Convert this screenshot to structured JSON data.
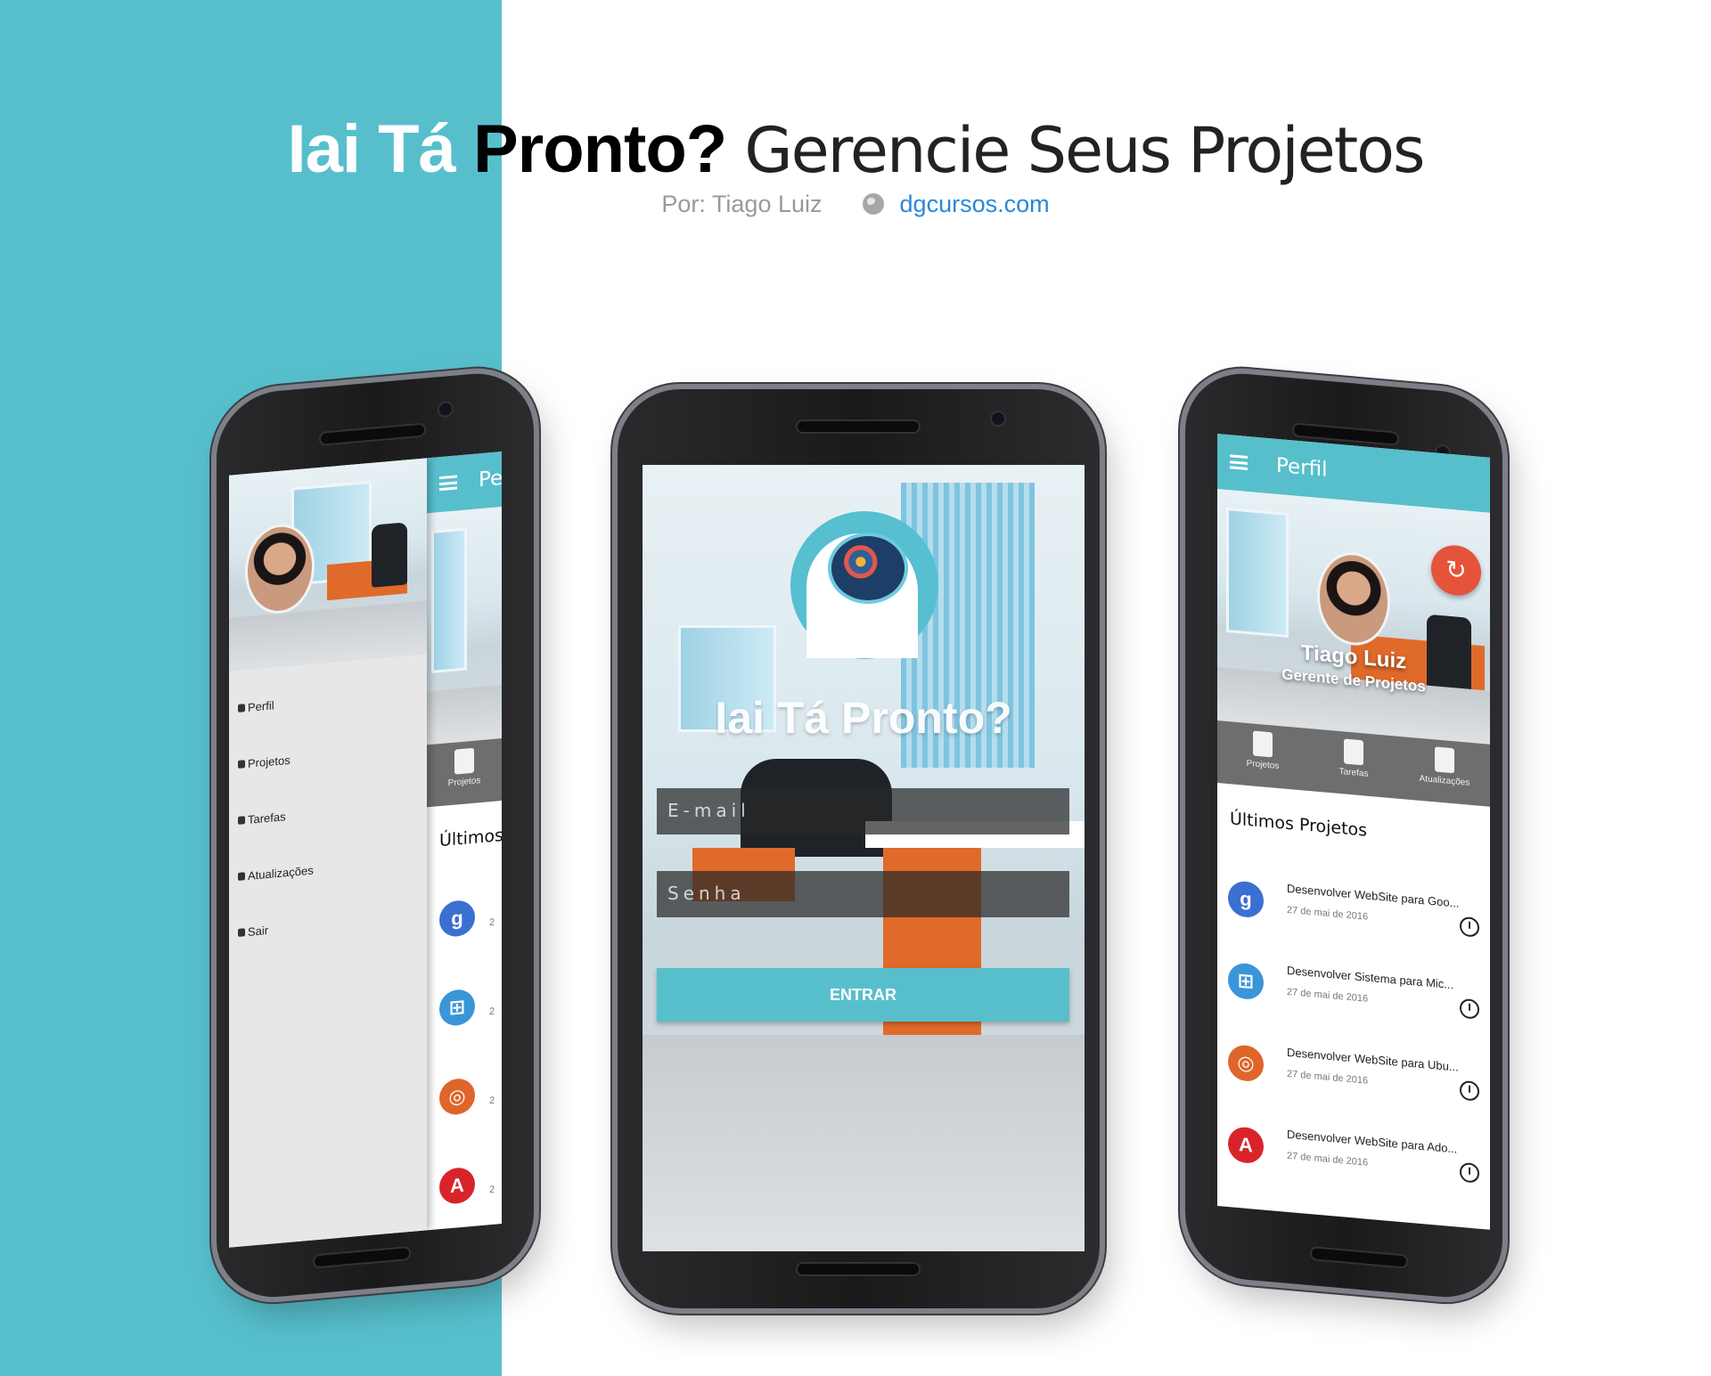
{
  "header": {
    "title_part1": "Iai Tá",
    "title_part2": "Pronto?",
    "title_part3": "Gerencie Seus Projetos",
    "byline": "Por: Tiago Luiz",
    "website": "dgcursos.com"
  },
  "colors": {
    "teal": "#57bfcc",
    "orange_fab": "#e6533b",
    "link": "#2a88d9"
  },
  "login_screen": {
    "app_title": "Iai Tá Pronto?",
    "email_placeholder": "E-mail",
    "password_placeholder": "Senha",
    "enter_button": "ENTRAR"
  },
  "profile_screen": {
    "appbar_title": "Perfil",
    "user_name": "Tiago Luiz",
    "user_role": "Gerente de Projetos",
    "tabs": [
      {
        "label": "Projetos",
        "icon": "folder-icon"
      },
      {
        "label": "Tarefas",
        "icon": "clipboard-icon"
      },
      {
        "label": "Atualizações",
        "icon": "users-icon"
      }
    ],
    "section_title": "Últimos Projetos",
    "projects": [
      {
        "name": "Desenvolver WebSite para Goo...",
        "date": "27 de mai de 2016",
        "icon": "google-icon",
        "color": "#3b6fd1",
        "glyph": "g"
      },
      {
        "name": "Desenvolver Sistema para Mic...",
        "date": "27 de mai de 2016",
        "icon": "windows-icon",
        "color": "#3b95d9",
        "glyph": "⊞"
      },
      {
        "name": "Desenvolver WebSite para Ubu...",
        "date": "27 de mai de 2016",
        "icon": "ubuntu-icon",
        "color": "#e0652b",
        "glyph": "◎"
      },
      {
        "name": "Desenvolver WebSite para Ado...",
        "date": "27 de mai de 2016",
        "icon": "adobe-icon",
        "color": "#d9232a",
        "glyph": "A"
      }
    ]
  },
  "drawer_screen": {
    "appbar_title_partial": "Pe",
    "menu": [
      {
        "label": "Perfil",
        "icon": "person-icon"
      },
      {
        "label": "Projetos",
        "icon": "folder-icon"
      },
      {
        "label": "Tarefas",
        "icon": "calendar-icon"
      },
      {
        "label": "Atualizações",
        "icon": "users-icon"
      },
      {
        "label": "Sair",
        "icon": "exit-icon"
      }
    ],
    "tab_label": "Projetos",
    "section_title_partial": "Últimos Pr",
    "project_date_partial": "2"
  }
}
